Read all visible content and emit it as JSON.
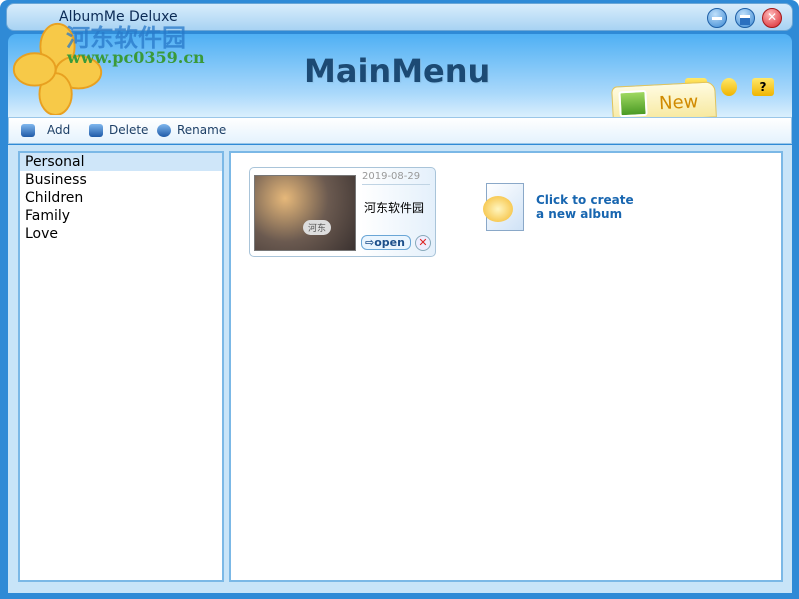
{
  "window": {
    "title": "AlbumMe Deluxe"
  },
  "watermark": {
    "text": "河东软件园",
    "url": "www.pc0359.cn"
  },
  "header": {
    "title": "MainMenu",
    "new_label": "New",
    "help_glyph": "?"
  },
  "toolbar": {
    "add": "Add",
    "delete": "Delete",
    "rename": "Rename"
  },
  "categories": [
    {
      "label": "Personal",
      "selected": true
    },
    {
      "label": "Business"
    },
    {
      "label": "Children"
    },
    {
      "label": "Family"
    },
    {
      "label": "Love"
    }
  ],
  "albums": [
    {
      "date": "2019-08-29",
      "name": "河东软件园",
      "thumb_text": "河东",
      "open_label": "open"
    }
  ],
  "create": {
    "line1": "Click to create",
    "line2": "a new album"
  }
}
